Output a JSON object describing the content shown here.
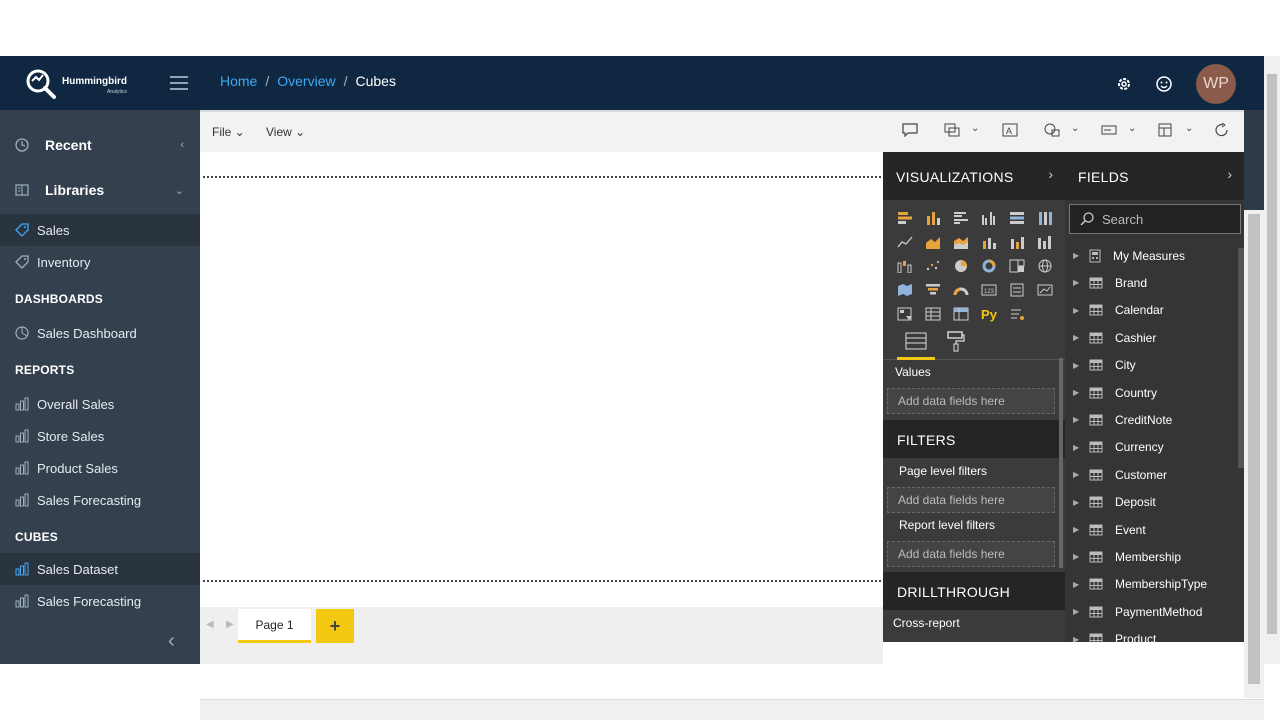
{
  "brand": {
    "name": "Hummingbird",
    "sub": "Analytics"
  },
  "breadcrumb": {
    "home": "Home",
    "overview": "Overview",
    "current": "Cubes",
    "sep": "/"
  },
  "user": {
    "initials": "WP"
  },
  "sidebar": {
    "recent": "Recent",
    "libraries": "Libraries",
    "libraries_items": [
      "Sales",
      "Inventory"
    ],
    "dashboards_title": "DASHBOARDS",
    "dashboards": [
      "Sales Dashboard"
    ],
    "reports_title": "REPORTS",
    "reports": [
      "Overall Sales",
      "Store Sales",
      "Product Sales",
      "Sales Forecasting"
    ],
    "cubes_title": "CUBES",
    "cubes": [
      "Sales Dataset",
      "Sales Forecasting"
    ]
  },
  "menu": {
    "file": "File",
    "view": "View"
  },
  "pages": {
    "page1": "Page 1",
    "add": "+"
  },
  "viz": {
    "title": "VISUALIZATIONS",
    "values_label": "Values",
    "add_fields": "Add data fields here",
    "filters_title": "FILTERS",
    "page_filters": "Page level filters",
    "report_filters": "Report level filters",
    "drill_title": "DRILLTHROUGH",
    "cross_report": "Cross-report",
    "py": "Py"
  },
  "fields": {
    "title": "FIELDS",
    "search_placeholder": "Search",
    "items": [
      "My Measures",
      "Brand",
      "Calendar",
      "Cashier",
      "City",
      "Country",
      "CreditNote",
      "Currency",
      "Customer",
      "Deposit",
      "Event",
      "Membership",
      "MembershipType",
      "PaymentMethod",
      "Product"
    ]
  },
  "colors": {
    "accent": "#f2c811",
    "topbar": "#0f2740",
    "link": "#3fa9f5"
  }
}
